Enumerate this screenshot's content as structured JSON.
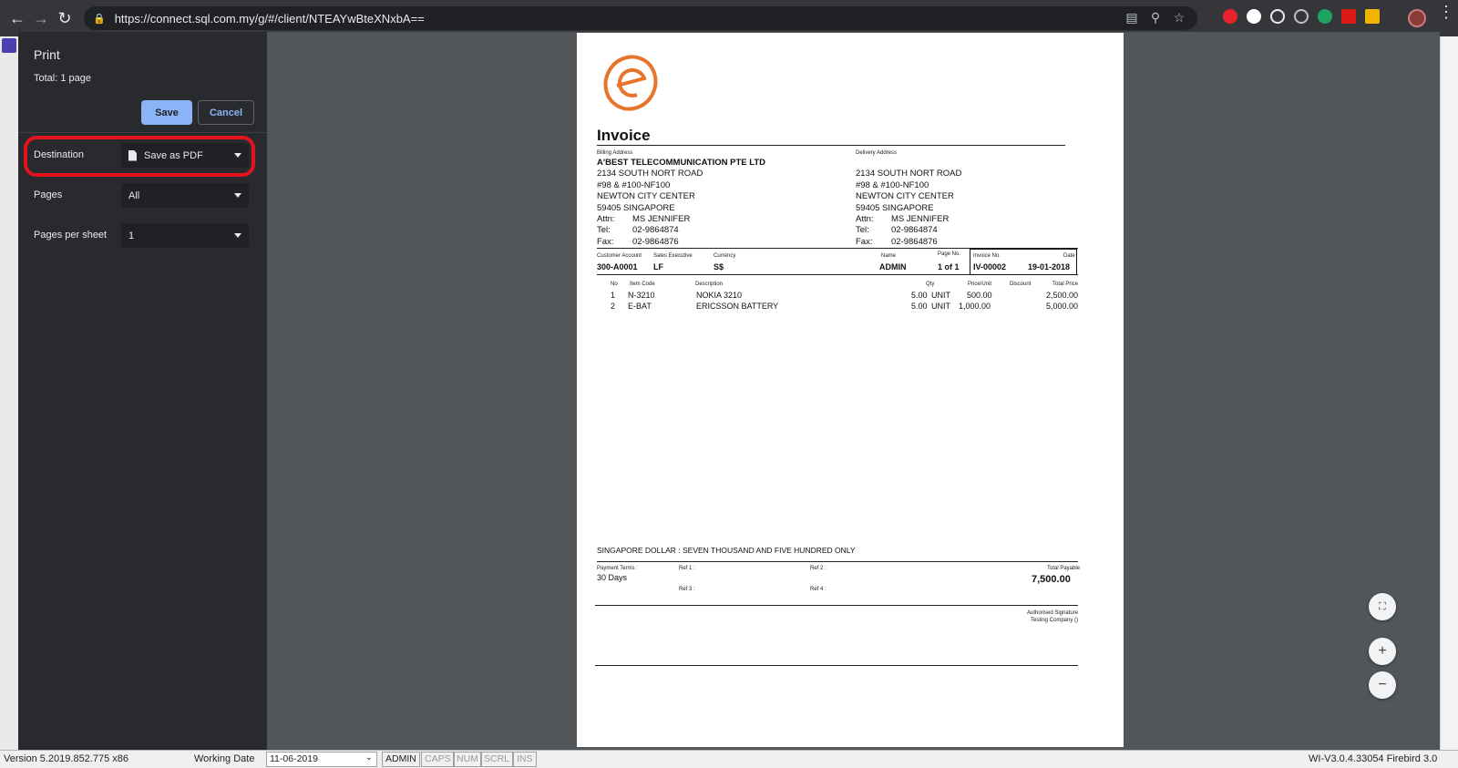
{
  "browser": {
    "url": "https://connect.sql.com.my/g/#/client/NTEAYwBteXNxbA==",
    "extension_colors": [
      "#e8232b",
      "#ffffff",
      "#e8eaed",
      "#bdc1c6",
      "#1fa463",
      "#dd1b16",
      "#f0b400"
    ]
  },
  "print_dialog": {
    "title": "Print",
    "total": "Total: 1 page",
    "save_label": "Save",
    "cancel_label": "Cancel",
    "destination_label": "Destination",
    "destination_value": "Save as PDF",
    "pages_label": "Pages",
    "pages_value": "All",
    "pages_per_sheet_label": "Pages per sheet",
    "pages_per_sheet_value": "1",
    "highlight_color": "#e3141d"
  },
  "invoice": {
    "title": "Invoice",
    "billing_label": "Billing Address",
    "delivery_label": "Delivery Address",
    "company": "A'BEST TELECOMMUNICATION PTE LTD",
    "billing_lines": [
      "2134 SOUTH NORT ROAD",
      "#98 & #100-NF100",
      "NEWTON CITY CENTER",
      "59405 SINGAPORE"
    ],
    "delivery_lines": [
      "2134 SOUTH NORT ROAD",
      "#98 & #100-NF100",
      "NEWTON CITY CENTER",
      "59405 SINGAPORE"
    ],
    "attn_label": "Attn:",
    "attn": "MS JENNIFER",
    "tel_label": "Tel:",
    "tel": "02-9864874",
    "fax_label": "Fax:",
    "fax": "02-9864876",
    "customer_account_label": "Customer Account",
    "customer_account": "300-A0001",
    "sales_exec_label": "Sales Executive",
    "sales_exec": "LF",
    "currency_label": "Currency",
    "currency": "S$",
    "name_label": "Name",
    "name": "ADMIN",
    "page_no_label": "Page No.",
    "page_no": "1 of 1",
    "invoice_no_label": "Invoice No.",
    "invoice_no": "IV-00002",
    "date_label": "Date",
    "date": "19-01-2018",
    "columns": [
      "No",
      "Item Code",
      "Description",
      "Qty",
      "Price/Unit",
      "Discount",
      "Total Price"
    ],
    "items": [
      {
        "no": "1",
        "code": "N-3210",
        "desc": "NOKIA 3210",
        "qty": "5.00",
        "uom": "UNIT",
        "price": "500.00",
        "total": "2,500.00"
      },
      {
        "no": "2",
        "code": "E-BAT",
        "desc": "ERICSSON BATTERY",
        "qty": "5.00",
        "uom": "UNIT",
        "price": "1,000.00",
        "total": "5,000.00"
      }
    ],
    "amount_words": "SINGAPORE DOLLAR : SEVEN THOUSAND AND FIVE HUNDRED ONLY",
    "payment_terms_label": "Payment Terms :",
    "payment_terms": "30 Days",
    "ref1_label": "Ref 1 :",
    "ref2_label": "Ref 2 :",
    "ref3_label": "Ref 3 :",
    "ref4_label": "Ref 4 :",
    "total_payable_label": "Total Payable",
    "total_payable": "7,500.00",
    "auth_sig_label": "Authorised Signature",
    "company_footer": "Testing Company ()",
    "logo_color": "#e8732a"
  },
  "statusbar": {
    "version": "Version 5.2019.852.775 x86",
    "working_date_label": "Working Date",
    "working_date": "11-06-2019",
    "user": "ADMIN",
    "caps": "CAPS",
    "num": "NUM",
    "scrl": "SCRL",
    "ins": "INS",
    "build": "WI-V3.0.4.33054 Firebird 3.0"
  }
}
